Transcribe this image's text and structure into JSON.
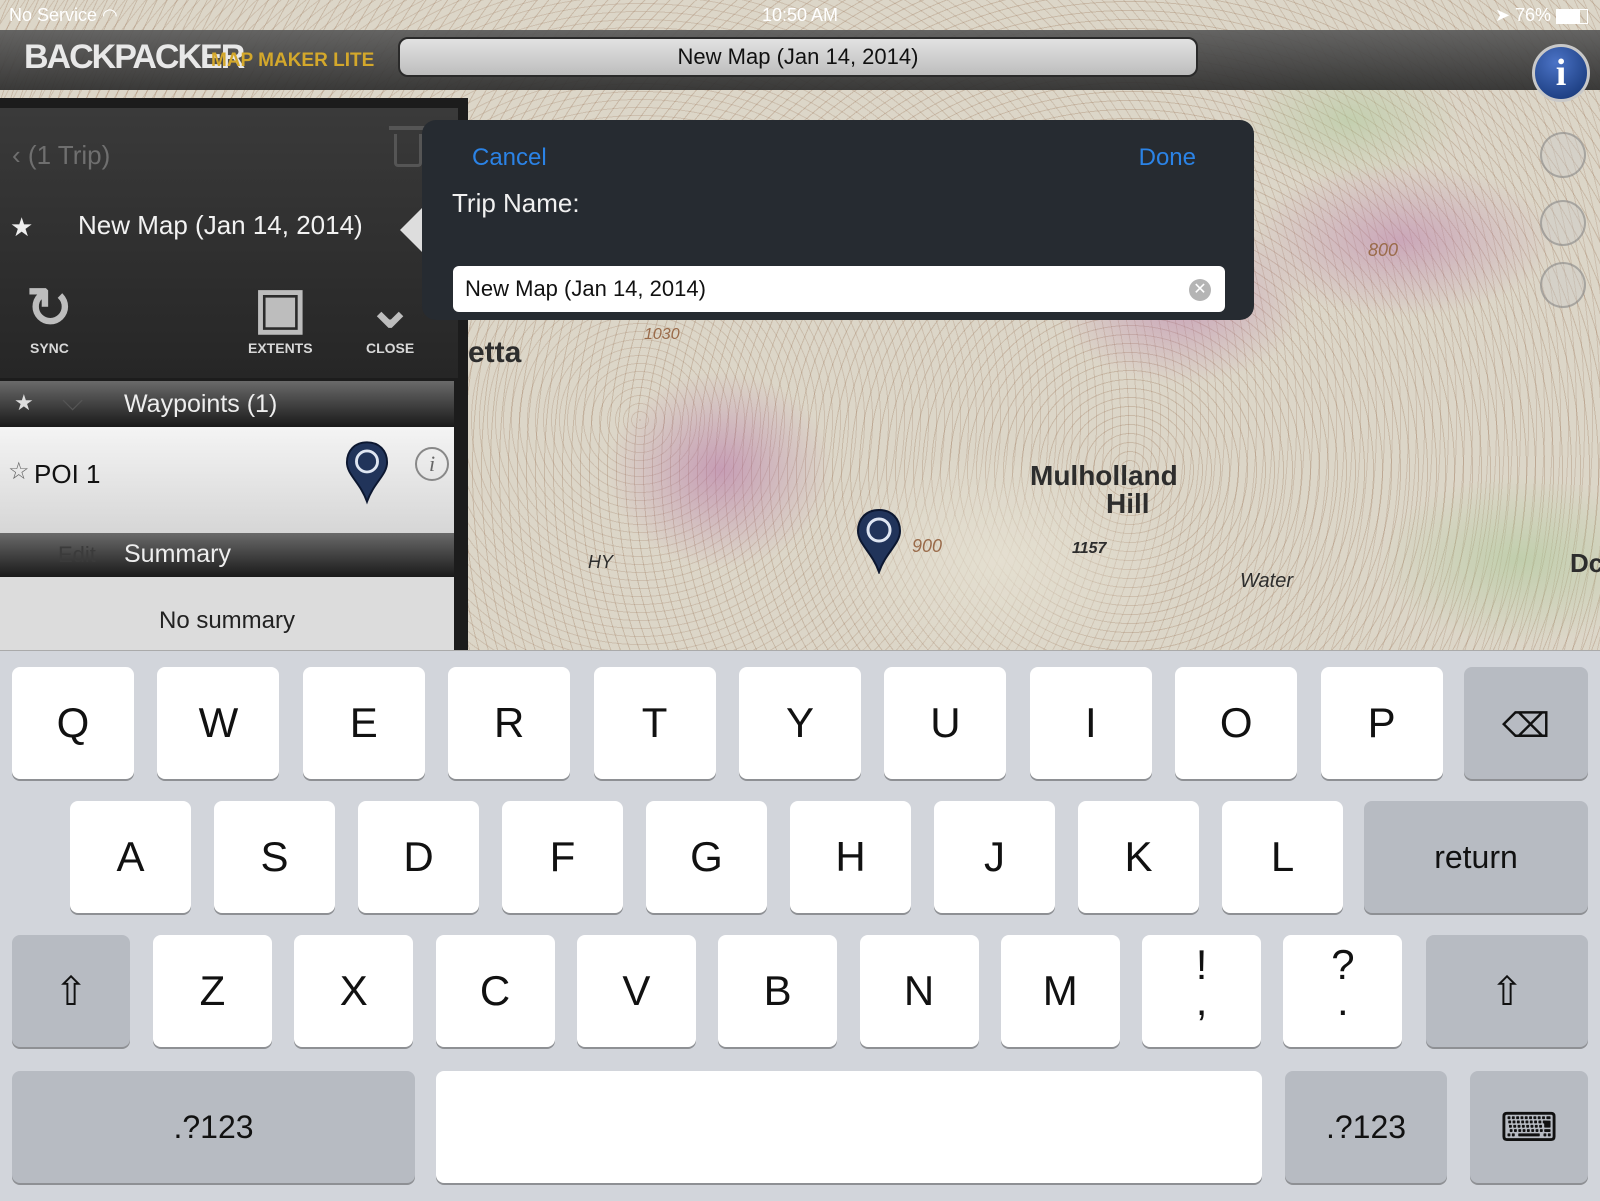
{
  "status_bar": {
    "carrier": "No Service",
    "time": "10:50 AM",
    "battery": "76%"
  },
  "app": {
    "brand": "BACKPACKER",
    "brand_sub": "MAP MAKER LITE",
    "map_title": "New Map (Jan 14, 2014)"
  },
  "panel": {
    "back_label": "(1 Trip)",
    "trip_name": "New Map (Jan 14, 2014)",
    "tools": {
      "sync": "SYNC",
      "extents": "EXTENTS",
      "close": "CLOSE"
    },
    "waypoints_header": "Waypoints (1)",
    "poi_label": "POI 1",
    "summary_edit": "Edit",
    "summary_header": "Summary",
    "summary_text": "No summary"
  },
  "dialog": {
    "cancel": "Cancel",
    "done": "Done",
    "label": "Trip Name:",
    "value": "New Map (Jan 14, 2014)"
  },
  "map_labels": {
    "place1": "Mulholland",
    "place2": "Hill",
    "partial": "etta",
    "water": "Water",
    "elev": "1157",
    "c800": "800",
    "c900": "900",
    "c1030": "1030",
    "hy": "HY",
    "dc": "Dc"
  },
  "keyboard": {
    "row1": [
      "Q",
      "W",
      "E",
      "R",
      "T",
      "Y",
      "U",
      "I",
      "O",
      "P"
    ],
    "row2": [
      "A",
      "S",
      "D",
      "F",
      "G",
      "H",
      "J",
      "K",
      "L"
    ],
    "row3": [
      "Z",
      "X",
      "C",
      "V",
      "B",
      "N",
      "M",
      "!\n,",
      "?\n."
    ],
    "return": "return",
    "numbers": ".?123"
  },
  "colors": {
    "accent": "#2b83e6",
    "brand_sub": "#d4a82b",
    "info_button": "#1e3f8a"
  }
}
